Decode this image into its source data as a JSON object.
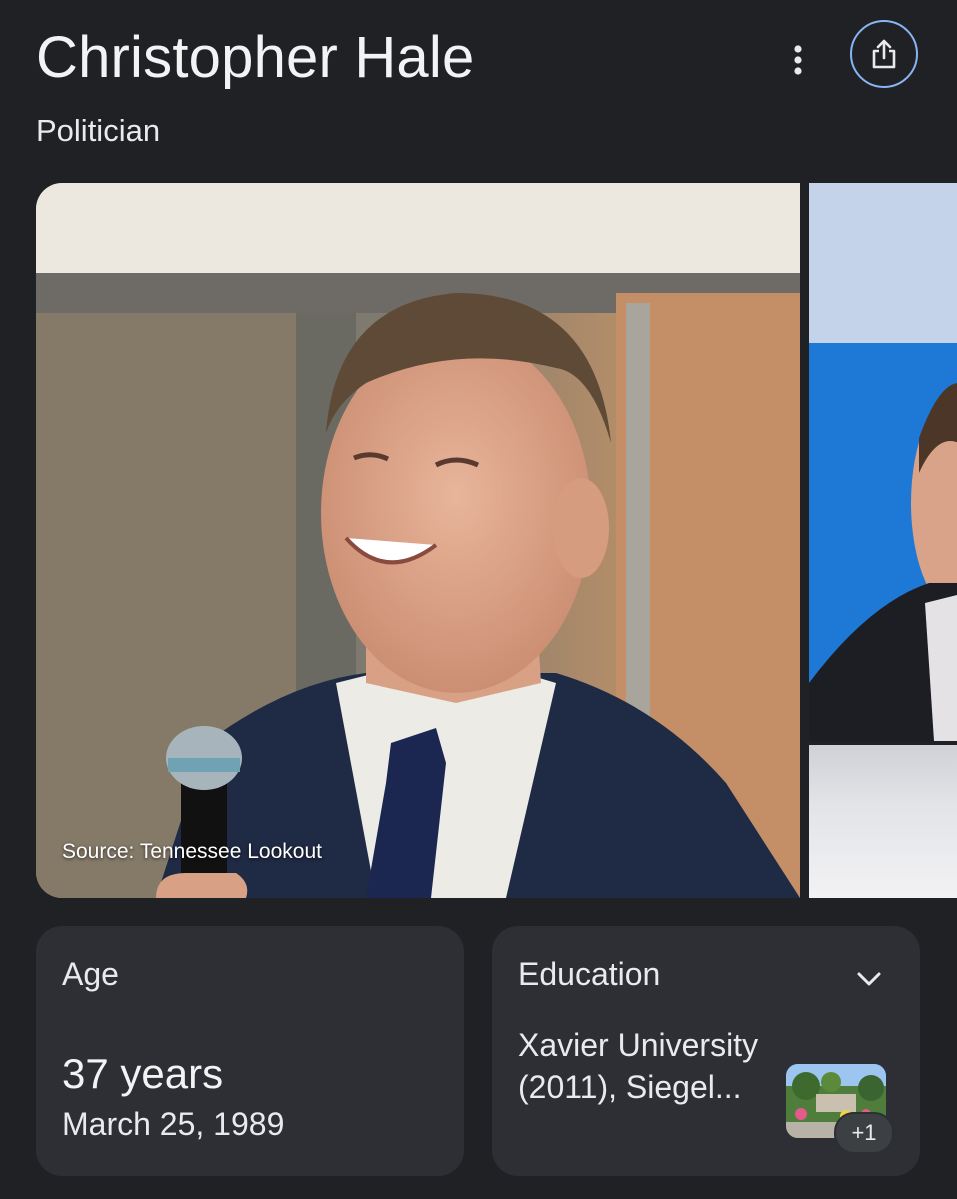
{
  "header": {
    "title": "Christopher Hale",
    "subtitle": "Politician"
  },
  "gallery": {
    "main_image_source": "Source: Tennessee Lookout"
  },
  "age_card": {
    "label": "Age",
    "value": "37 years",
    "birth_date": "March 25, 1989"
  },
  "education_card": {
    "label": "Education",
    "text": "Xavier University (2011), Siegel...",
    "more_count": "+1"
  },
  "colors": {
    "background": "#202124",
    "card": "#2d2f34",
    "accent": "#8ab4f8"
  }
}
